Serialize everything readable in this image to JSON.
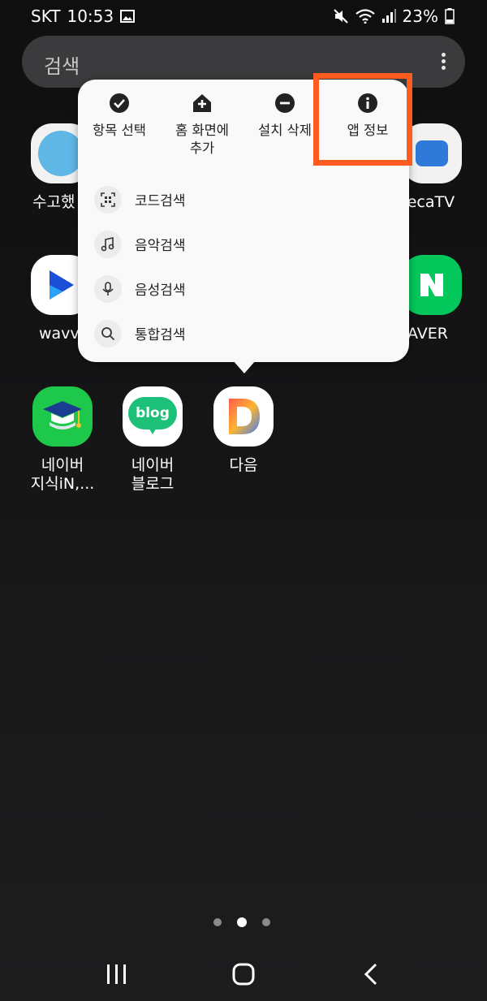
{
  "status": {
    "carrier": "SKT",
    "time": "10:53",
    "battery": "23%",
    "icons": [
      "gallery-icon",
      "mute-icon",
      "wifi-icon",
      "signal-icon",
      "battery-icon"
    ]
  },
  "search": {
    "placeholder": "검색"
  },
  "background_apps": {
    "row1": [
      {
        "name": "suogohaesseo-app",
        "label": "수고했"
      },
      {
        "name": "deecatv-app",
        "label": "eecaTV"
      }
    ],
    "row2": [
      {
        "name": "wavve-app",
        "label": "wavv"
      },
      {
        "name": "naver-app",
        "label": "AVER"
      }
    ]
  },
  "apps": [
    {
      "name": "naver-kin-app",
      "label": "네이버\n지식iN,...",
      "line1": "네이버",
      "line2": "지식iN,..."
    },
    {
      "name": "naver-blog-app",
      "label": "네이버 블로그",
      "line1": "네이버",
      "line2": "블로그",
      "icon_text": "blog"
    },
    {
      "name": "daum-app",
      "line1": "다음"
    }
  ],
  "context_menu": {
    "top_actions": [
      {
        "icon": "check-circle-icon",
        "label": "항목 선택"
      },
      {
        "icon": "add-home-icon",
        "label1": "홈 화면에",
        "label2": "추가"
      },
      {
        "icon": "minus-circle-icon",
        "label": "설치 삭제"
      },
      {
        "icon": "info-icon",
        "label": "앱 정보"
      }
    ],
    "shortcuts": [
      {
        "icon": "qr-code-icon",
        "label": "코드검색"
      },
      {
        "icon": "music-note-icon",
        "label": "음악검색"
      },
      {
        "icon": "microphone-icon",
        "label": "음성검색"
      },
      {
        "icon": "search-icon",
        "label": "통합검색"
      }
    ]
  },
  "page_indicator": {
    "count": 3,
    "active": 1
  },
  "colors": {
    "highlight": "#ff5a1f",
    "naver_green": "#03c75a",
    "menu_bg": "#f9f9f9"
  }
}
